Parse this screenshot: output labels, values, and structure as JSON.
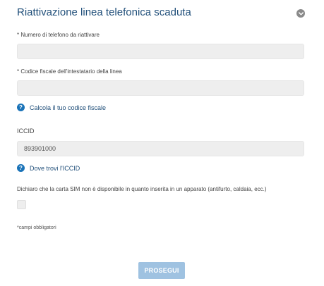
{
  "header": {
    "title": "Riattivazione linea telefonica scaduta",
    "collapse_icon": "chevron-down-icon"
  },
  "form": {
    "phone": {
      "label": "* Numero di telefono da riattivare",
      "value": "",
      "placeholder": ""
    },
    "fiscal_code": {
      "label": "* Codice fiscale dell'intestatario della linea",
      "value": "",
      "placeholder": ""
    },
    "fiscal_help": {
      "icon": "help-icon",
      "text": "Calcola il tuo codice fiscale"
    },
    "iccid": {
      "label": "ICCID",
      "value": "893901000"
    },
    "iccid_help": {
      "icon": "help-icon",
      "text": "Dove trovi l'ICCID"
    },
    "declaration": {
      "text": "Dichiaro che la carta SIM non è disponibile in quanto inserita in un apparato (antifurto, caldaia, ecc.)",
      "checked": false
    },
    "required_note": "*campi obbligatori",
    "submit_label": "PROSEGUI"
  },
  "colors": {
    "title": "#1f4e79",
    "link": "#1f4e79",
    "help_icon_bg": "#1a73b8",
    "field_bg": "#eeeeee",
    "button_bg": "#9fc2e1"
  }
}
